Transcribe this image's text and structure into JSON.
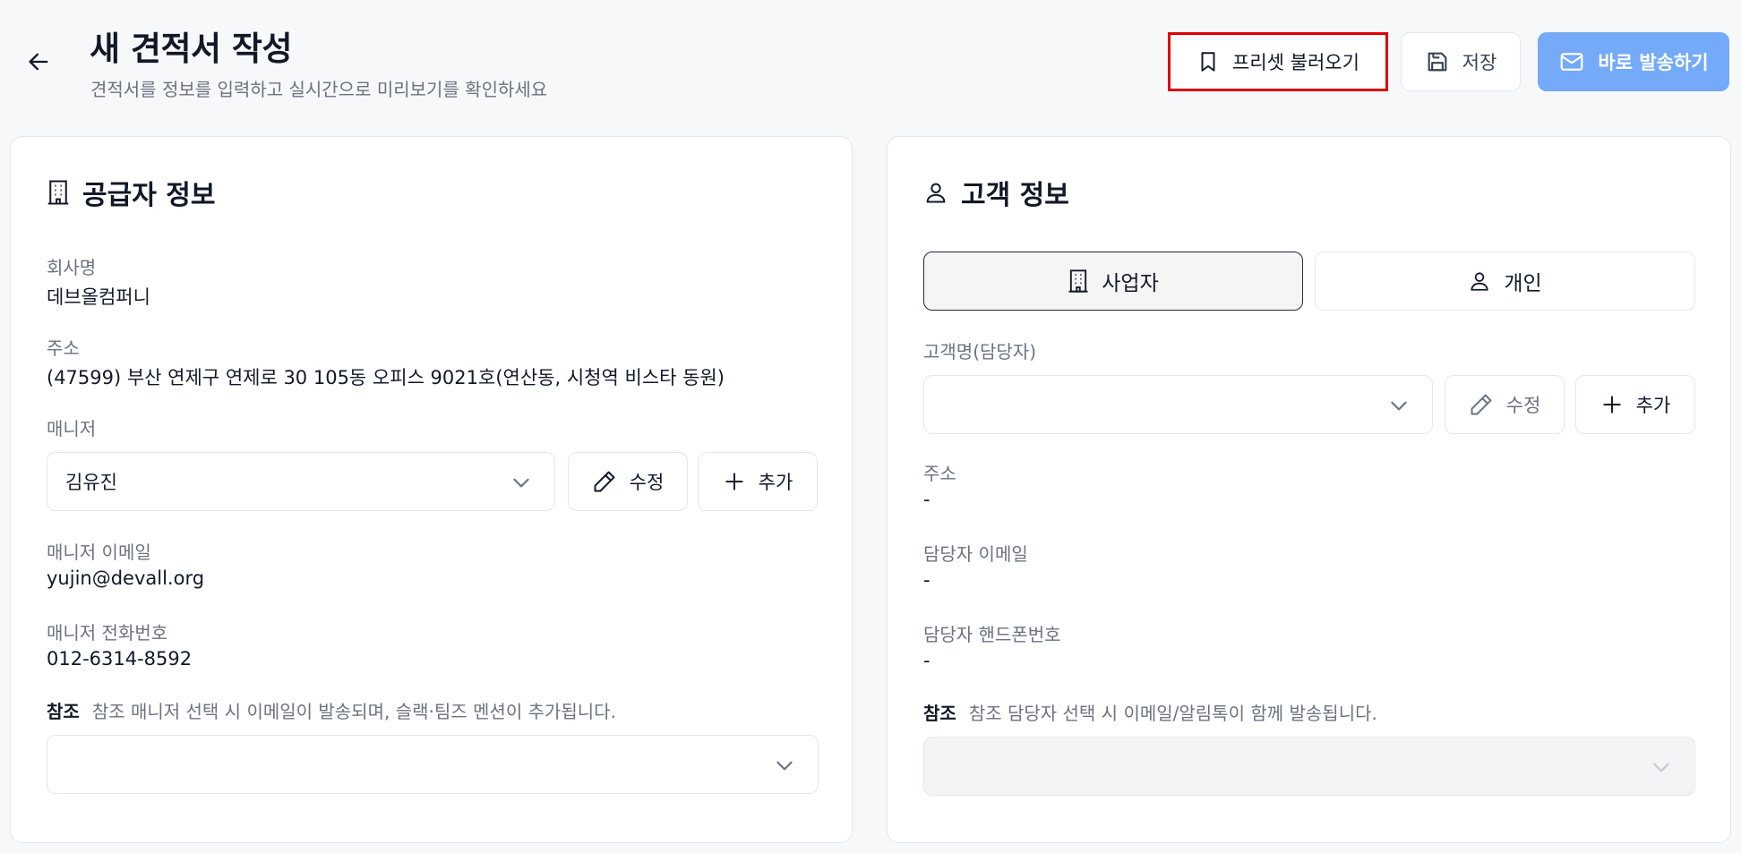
{
  "header": {
    "title": "새 견적서 작성",
    "subtitle": "견적서를 정보를 입력하고 실시간으로 미리보기를 확인하세요",
    "preset_label": "프리셋 불러오기",
    "save_label": "저장",
    "send_label": "바로 발송하기"
  },
  "supplier": {
    "title": "공급자 정보",
    "company_label": "회사명",
    "company_value": "데브올컴퍼니",
    "address_label": "주소",
    "address_value": "(47599) 부산 연제구 연제로 30 105동 오피스 9021호(연산동, 시청역 비스타 동원)",
    "manager_label": "매니저",
    "manager_value": "김유진",
    "edit_label": "수정",
    "add_label": "추가",
    "email_label": "매니저 이메일",
    "email_value": "yujin@devall.org",
    "phone_label": "매니저 전화번호",
    "phone_value": "012-6314-8592",
    "note_key": "참조",
    "note_text": "참조 매니저 선택 시 이메일이 발송되며, 슬랙·팀즈 멘션이 추가됩니다.",
    "reference_value": ""
  },
  "customer": {
    "title": "고객 정보",
    "tab_business": "사업자",
    "tab_individual": "개인",
    "name_label": "고객명(담당자)",
    "name_value": "",
    "edit_label": "수정",
    "add_label": "추가",
    "address_label": "주소",
    "address_value": "-",
    "email_label": "담당자 이메일",
    "email_value": "-",
    "phone_label": "담당자 핸드폰번호",
    "phone_value": "-",
    "note_key": "참조",
    "note_text": "참조 담당자 선택 시 이메일/알림톡이 함께 발송됩니다.",
    "reference_value": ""
  }
}
